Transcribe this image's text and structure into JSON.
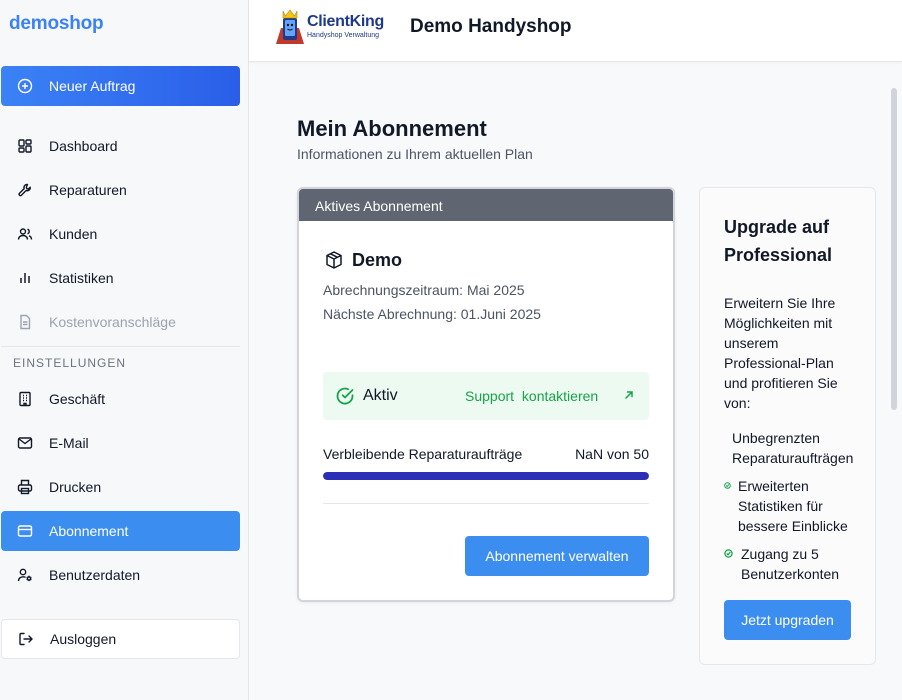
{
  "sidebar": {
    "brand": "demoshop",
    "new_order_label": "Neuer Auftrag",
    "items": [
      {
        "label": "Dashboard",
        "icon": "dashboard-icon"
      },
      {
        "label": "Reparaturen",
        "icon": "wrench-icon"
      },
      {
        "label": "Kunden",
        "icon": "users-icon"
      },
      {
        "label": "Statistiken",
        "icon": "bar-chart-icon"
      },
      {
        "label": "Kostenvoranschläge",
        "icon": "document-icon",
        "disabled": true
      }
    ],
    "settings_label": "EINSTELLUNGEN",
    "settings_items": [
      {
        "label": "Geschäft",
        "icon": "building-icon"
      },
      {
        "label": "E-Mail",
        "icon": "mail-icon"
      },
      {
        "label": "Drucken",
        "icon": "printer-icon"
      },
      {
        "label": "Abonnement",
        "icon": "credit-card-icon",
        "active": true
      },
      {
        "label": "Benutzerdaten",
        "icon": "user-settings-icon"
      }
    ],
    "logout_label": "Ausloggen"
  },
  "header": {
    "logo_name": "ClientKing",
    "logo_subtitle": "Handyshop Verwaltung",
    "shop_name": "Demo Handyshop"
  },
  "main": {
    "title": "Mein Abonnement",
    "subtitle": "Informationen zu Ihrem aktuellen Plan",
    "subscription": {
      "header": "Aktives Abonnement",
      "plan_name": "Demo",
      "billing_period": "Abrechnungszeitraum: Mai 2025",
      "next_billing": "Nächste Abrechnung: 01.Juni 2025",
      "status": "Aktiv",
      "support_link": "Support kontaktieren",
      "remaining_label": "Verbleibende Reparaturaufträge",
      "remaining_value": "NaN von 50",
      "remaining_fraction": 1.0,
      "manage_button": "Abonnement verwalten"
    },
    "upgrade": {
      "title": "Upgrade auf Professional",
      "description": "Erweitern Sie Ihre Möglichkeiten mit unserem Professional-Plan und profitieren Sie von:",
      "features": [
        "Unbegrenzten Reparaturaufträgen",
        "Erweiterten Statistiken für bessere Einblicke",
        "Zugang zu 5 Benutzerkonten"
      ],
      "button": "Jetzt upgraden"
    }
  },
  "colors": {
    "accent": "#3b8ef0",
    "brand": "#3b82f6",
    "success": "#16a34a",
    "progress": "#2b2fb8",
    "card_header": "#5f6672"
  }
}
